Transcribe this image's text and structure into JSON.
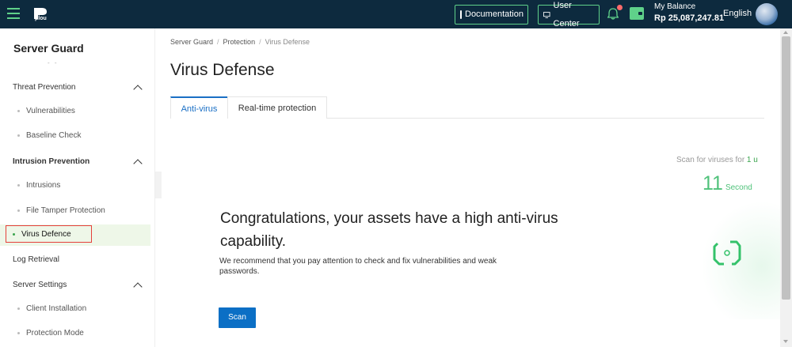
{
  "topbar": {
    "logo_text": "plou",
    "documentation_label": "Documentation",
    "user_center_label": "User Center",
    "balance_label": "My Balance",
    "balance_value": "Rp 25,087,247.81",
    "language": "English",
    "accent_color": "#5fd18a",
    "background_color": "#0d2a3e"
  },
  "sidebar": {
    "title": "Server Guard",
    "faint_text": "- -",
    "groups": [
      {
        "label": "Threat Prevention",
        "expanded": true,
        "items": [
          "Vulnerabilities",
          "Baseline Check"
        ]
      },
      {
        "label": "Intrusion Prevention",
        "expanded": true,
        "items": [
          "Intrusions",
          "File Tamper Protection",
          "Virus Defence"
        ]
      },
      {
        "label": "Log Retrieval"
      },
      {
        "label": "Server Settings",
        "expanded": true,
        "items": [
          "Client Installation",
          "Protection Mode"
        ]
      }
    ],
    "active_item": "Virus Defence"
  },
  "breadcrumb": [
    "Server Guard",
    "Protection",
    "Virus Defense"
  ],
  "page_title": "Virus Defense",
  "tabs": [
    {
      "label": "Anti-virus",
      "active": true
    },
    {
      "label": "Real-time protection",
      "active": false
    }
  ],
  "hero": {
    "title": "Congratulations, your assets have a high anti-virus capability.",
    "description": "We recommend that you pay attention to check and fix vulnerabilities and weak passwords.",
    "scan_label": "Scan"
  },
  "scan_status": {
    "prefix": "Scan for viruses for ",
    "highlight": "1 u",
    "timer_value": "11",
    "timer_unit": "Second"
  }
}
